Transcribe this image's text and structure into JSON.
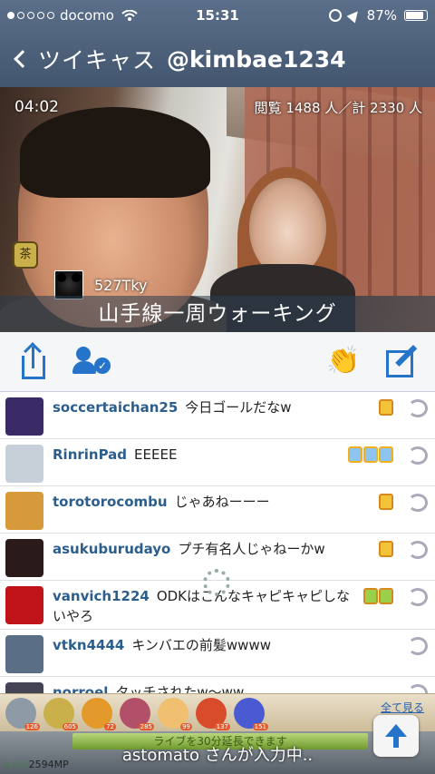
{
  "status": {
    "carrier": "docomo",
    "time": "15:31",
    "battery": "87%"
  },
  "nav": {
    "back_label": "ツイキャス",
    "title": "@kimbae1234"
  },
  "video": {
    "elapsed": "04:02",
    "views": "閲覧 1488 人／計 2330 人",
    "tea_icon_text": "茶",
    "broadcaster_name": "527Tky",
    "title": "山手線一周ウォーキング"
  },
  "comments": [
    {
      "user": "soccertaichan25",
      "text": "今日ゴールだなw",
      "avatar_color": "#3a2a66",
      "badges": [
        "gold"
      ]
    },
    {
      "user": "RinrinPad",
      "text": "EEEEE",
      "avatar_color": "#c7d0d9",
      "badges": [
        "blue",
        "blue",
        "blue"
      ]
    },
    {
      "user": "torotorocombu",
      "text": "じゃあねーーー",
      "avatar_color": "#d69a3a",
      "badges": [
        "gold"
      ]
    },
    {
      "user": "asukuburudayo",
      "text": "プチ有名人じゃねーかw",
      "avatar_color": "#2a1a1a",
      "badges": [
        "gold"
      ]
    },
    {
      "user": "vanvich1224",
      "text": "ODKはこんなキャピキャピしないやろ",
      "avatar_color": "#c0141a",
      "badges": [
        "green",
        "green"
      ]
    },
    {
      "user": "vtkn4444",
      "text": "キンバエの前髪wwww",
      "avatar_color": "#5a6f85",
      "badges": []
    },
    {
      "user": "norroel",
      "text": "タッチされたw～ww",
      "avatar_color": "#445",
      "badges": []
    }
  ],
  "gifts": [
    {
      "name": "coin",
      "count": "126",
      "color": "#8e9aa6"
    },
    {
      "name": "tea",
      "count": "605",
      "color": "#c9b04a"
    },
    {
      "name": "cracker",
      "count": "72",
      "color": "#e49a2a"
    },
    {
      "name": "cupcake",
      "count": "285",
      "color": "#b2506a"
    },
    {
      "name": "clap",
      "count": "99",
      "color": "#f0c070"
    },
    {
      "name": "daruma",
      "count": "137",
      "color": "#d84c2c"
    },
    {
      "name": "firework",
      "count": "151",
      "color": "#4a5ad0"
    }
  ],
  "see_all": "全て見る",
  "extend_text": "ライブを30分延長できます",
  "typing_text": "astomato さんが入力中..",
  "mp_text": "2594MP",
  "colors": {
    "accent": "#2574c9",
    "navbar": "#4a5e78"
  }
}
